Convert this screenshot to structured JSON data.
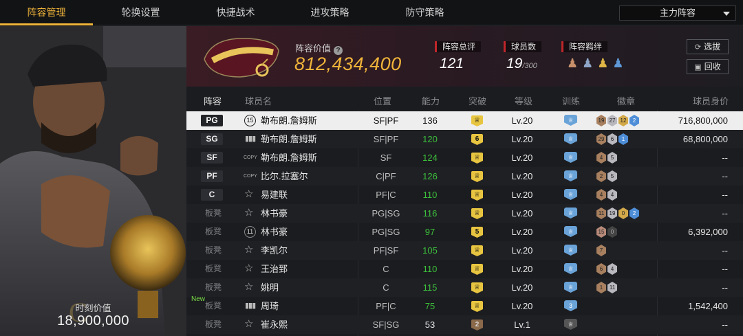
{
  "tabs": [
    "阵容管理",
    "轮换设置",
    "快捷战术",
    "进攻策略",
    "防守策略"
  ],
  "lineup_select": "主力阵容",
  "hero": {
    "value_label": "时刻价值",
    "value": "18,900,000"
  },
  "header": {
    "value_label": "阵容价值",
    "value": "812,434,400",
    "rating_label": "阵容总评",
    "rating": "121",
    "count_label": "球员数",
    "count": "19",
    "count_max": "/300",
    "chem_label": "阵容羁绊",
    "btn_scout": "选拔",
    "btn_recycle": "回收"
  },
  "columns": {
    "lineup": "阵容",
    "name": "球员名",
    "position": "位置",
    "ability": "能力",
    "breakthrough": "突破",
    "level": "等级",
    "training": "训练",
    "badges": "徽章",
    "value": "球员身价"
  },
  "rows": [
    {
      "slot": "PG",
      "icon": "num",
      "icon_text": "15",
      "name": "勒布朗.詹姆斯",
      "position": "SF|PF",
      "ability": "136",
      "brk": "",
      "level": "Lv.20",
      "trn": "",
      "badges": [
        [
          "19",
          "br"
        ],
        [
          "27",
          "sv"
        ],
        [
          "12",
          "gd"
        ],
        [
          "2",
          "bl"
        ]
      ],
      "value": "716,800,000"
    },
    {
      "slot": "SG",
      "icon": "bar",
      "name": "勒布朗.詹姆斯",
      "position": "SF|PF",
      "ability": "120",
      "brk": "6",
      "level": "Lv.20",
      "trn": "",
      "badges": [
        [
          "29",
          "br"
        ],
        [
          "6",
          "sv"
        ],
        [
          "1",
          "bl"
        ]
      ],
      "value": "68,800,000"
    },
    {
      "slot": "SF",
      "icon": "copy",
      "name": "勒布朗.詹姆斯",
      "position": "SF",
      "ability": "124",
      "brk": "",
      "level": "Lv.20",
      "trn": "",
      "badges": [
        [
          "4",
          "br"
        ],
        [
          "5",
          "sv"
        ]
      ],
      "value": "--"
    },
    {
      "slot": "PF",
      "icon": "copy",
      "name": "比尔.拉塞尔",
      "position": "C|PF",
      "ability": "126",
      "brk": "",
      "level": "Lv.20",
      "trn": "",
      "badges": [
        [
          "2",
          "br"
        ],
        [
          "5",
          "sv"
        ]
      ],
      "value": "--"
    },
    {
      "slot": "C",
      "icon": "star",
      "name": "易建联",
      "position": "PF|C",
      "ability": "110",
      "brk": "",
      "level": "Lv.20",
      "trn": "",
      "badges": [
        [
          "4",
          "br"
        ],
        [
          "4",
          "sv"
        ]
      ],
      "value": "--"
    },
    {
      "slot": "板凳",
      "icon": "star",
      "name": "林书豪",
      "position": "PG|SG",
      "ability": "116",
      "brk": "",
      "level": "Lv.20",
      "trn": "",
      "badges": [
        [
          "11",
          "br"
        ],
        [
          "19",
          "sv"
        ],
        [
          "0",
          "gd"
        ],
        [
          "2",
          "bl"
        ]
      ],
      "value": "--"
    },
    {
      "slot": "板凳",
      "icon": "num",
      "icon_text": "11",
      "name": "林书豪",
      "position": "PG|SG",
      "ability": "97",
      "brk": "5",
      "level": "Lv.20",
      "trn": "",
      "badges": [
        [
          "15",
          "pk"
        ],
        [
          "0",
          "dk"
        ]
      ],
      "value": "6,392,000"
    },
    {
      "slot": "板凳",
      "icon": "star",
      "name": "李凯尔",
      "position": "PF|SF",
      "ability": "105",
      "brk": "",
      "level": "Lv.20",
      "trn": "",
      "badges": [
        [
          "7",
          "br"
        ]
      ],
      "value": "--"
    },
    {
      "slot": "板凳",
      "icon": "star",
      "name": "王治郅",
      "position": "C",
      "ability": "110",
      "brk": "",
      "level": "Lv.20",
      "trn": "",
      "badges": [
        [
          "6",
          "br"
        ],
        [
          "4",
          "sv"
        ]
      ],
      "value": "--"
    },
    {
      "slot": "板凳",
      "icon": "star",
      "name": "姚明",
      "position": "C",
      "ability": "115",
      "brk": "",
      "level": "Lv.20",
      "trn": "",
      "badges": [
        [
          "1",
          "br"
        ],
        [
          "11",
          "sv"
        ]
      ],
      "value": "--"
    },
    {
      "slot": "板凳",
      "new": "New",
      "icon": "bar",
      "name": "周琦",
      "position": "PF|C",
      "ability": "75",
      "brk": "",
      "level": "Lv.20",
      "trn": "3",
      "badges": [],
      "value": "1,542,400"
    },
    {
      "slot": "板凳",
      "icon": "star",
      "name": "崔永熙",
      "position": "SF|SG",
      "ability": "53",
      "brk": "2",
      "level": "Lv.1",
      "trn": "",
      "badges": [],
      "value": "--"
    }
  ],
  "colors": {
    "accent": "#f0b43a",
    "green": "#3cc13c",
    "red": "#c0262b"
  }
}
